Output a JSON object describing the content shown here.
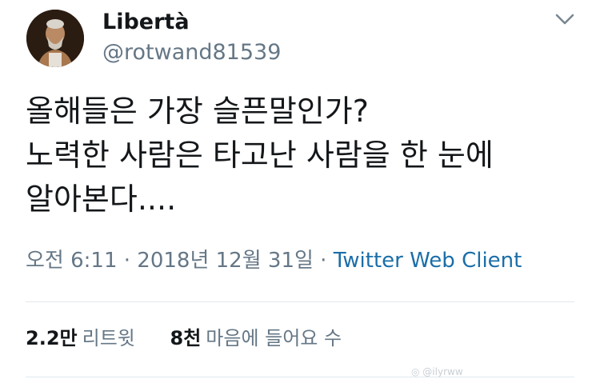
{
  "user": {
    "display_name": "Libertà",
    "handle": "@rotwand81539",
    "avatar_icon": "portrait-avatar"
  },
  "menu": {
    "icon": "chevron-down-icon"
  },
  "tweet": {
    "lines": [
      "올해들은 가장 슬픈말인가?",
      "노력한 사람은 타고난 사람을 한 눈에",
      "알아본다...."
    ]
  },
  "meta": {
    "timestamp": "오전 6:11 · 2018년 12월 31일",
    "separator": " · ",
    "source": "Twitter Web Client"
  },
  "stats": {
    "retweets": {
      "count": "2.2만",
      "label": "리트윗"
    },
    "likes": {
      "count": "8천",
      "label": "마음에 들어요 수"
    }
  },
  "watermark": {
    "icon": "weibo-icon",
    "text": "@ilyrww"
  },
  "colors": {
    "text": "#14171a",
    "secondary": "#657786",
    "link": "#1b6ea8",
    "divider": "#e1e8ed"
  }
}
